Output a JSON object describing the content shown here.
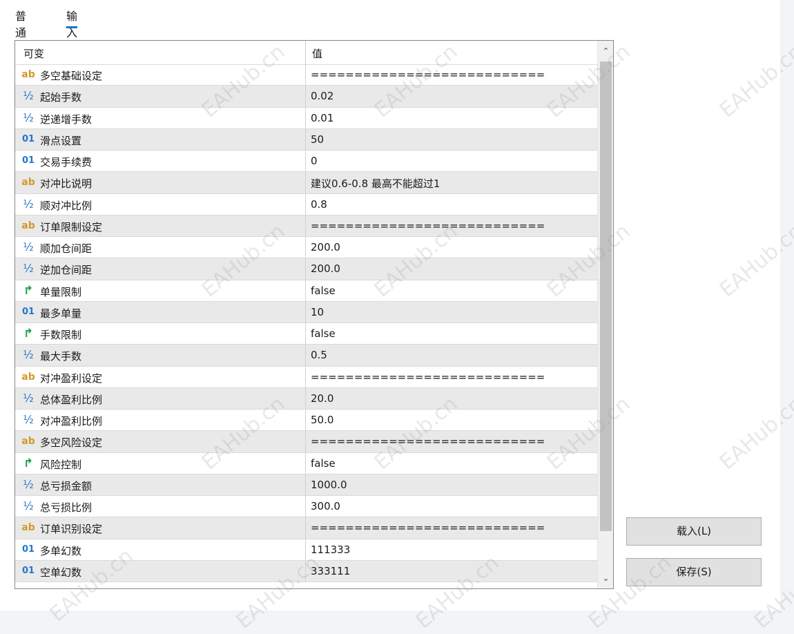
{
  "tabs": [
    {
      "label": "普通",
      "active": false
    },
    {
      "label": "输入",
      "active": true
    }
  ],
  "grid": {
    "col_variable": "可变",
    "col_value": "值",
    "rows": [
      {
        "type": "ab",
        "icon": "ab",
        "name": "多空基础设定",
        "value": "==========================="
      },
      {
        "type": "double",
        "icon": "½",
        "name": "起始手数",
        "value": "0.02"
      },
      {
        "type": "double",
        "icon": "½",
        "name": "逆递增手数",
        "value": "0.01"
      },
      {
        "type": "int",
        "icon": "01",
        "name": "滑点设置",
        "value": "50"
      },
      {
        "type": "int",
        "icon": "01",
        "name": "交易手续费",
        "value": "0"
      },
      {
        "type": "ab",
        "icon": "ab",
        "name": "对冲比说明",
        "value": "建议0.6-0.8 最高不能超过1"
      },
      {
        "type": "double",
        "icon": "½",
        "name": "顺对冲比例",
        "value": "0.8"
      },
      {
        "type": "ab",
        "icon": "ab",
        "name": "订单限制设定",
        "value": "==========================="
      },
      {
        "type": "double",
        "icon": "½",
        "name": "顺加仓间距",
        "value": "200.0"
      },
      {
        "type": "double",
        "icon": "½",
        "name": "逆加仓间距",
        "value": "200.0"
      },
      {
        "type": "bool",
        "icon": "↱",
        "name": "单量限制",
        "value": "false"
      },
      {
        "type": "int",
        "icon": "01",
        "name": "最多单量",
        "value": "10"
      },
      {
        "type": "bool",
        "icon": "↱",
        "name": "手数限制",
        "value": "false"
      },
      {
        "type": "double",
        "icon": "½",
        "name": "最大手数",
        "value": "0.5"
      },
      {
        "type": "ab",
        "icon": "ab",
        "name": "对冲盈利设定",
        "value": "==========================="
      },
      {
        "type": "double",
        "icon": "½",
        "name": "总体盈利比例",
        "value": "20.0"
      },
      {
        "type": "double",
        "icon": "½",
        "name": "对冲盈利比例",
        "value": "50.0"
      },
      {
        "type": "ab",
        "icon": "ab",
        "name": "多空风险设定",
        "value": "==========================="
      },
      {
        "type": "bool",
        "icon": "↱",
        "name": "风险控制",
        "value": "false"
      },
      {
        "type": "double",
        "icon": "½",
        "name": "总亏损金额",
        "value": "1000.0"
      },
      {
        "type": "double",
        "icon": "½",
        "name": "总亏损比例",
        "value": "300.0"
      },
      {
        "type": "ab",
        "icon": "ab",
        "name": "订单识别设定",
        "value": "==========================="
      },
      {
        "type": "int",
        "icon": "01",
        "name": "多单幻数",
        "value": "111333"
      },
      {
        "type": "int",
        "icon": "01",
        "name": "空单幻数",
        "value": "333111"
      }
    ]
  },
  "buttons": {
    "load": "载入(L)",
    "save": "保存(S)"
  },
  "watermark": "EAHub.cn",
  "colors": {
    "accent": "#1874c8",
    "string_icon": "#d09a2a",
    "number_icon": "#2276cc",
    "bool_icon": "#1ca04a"
  }
}
